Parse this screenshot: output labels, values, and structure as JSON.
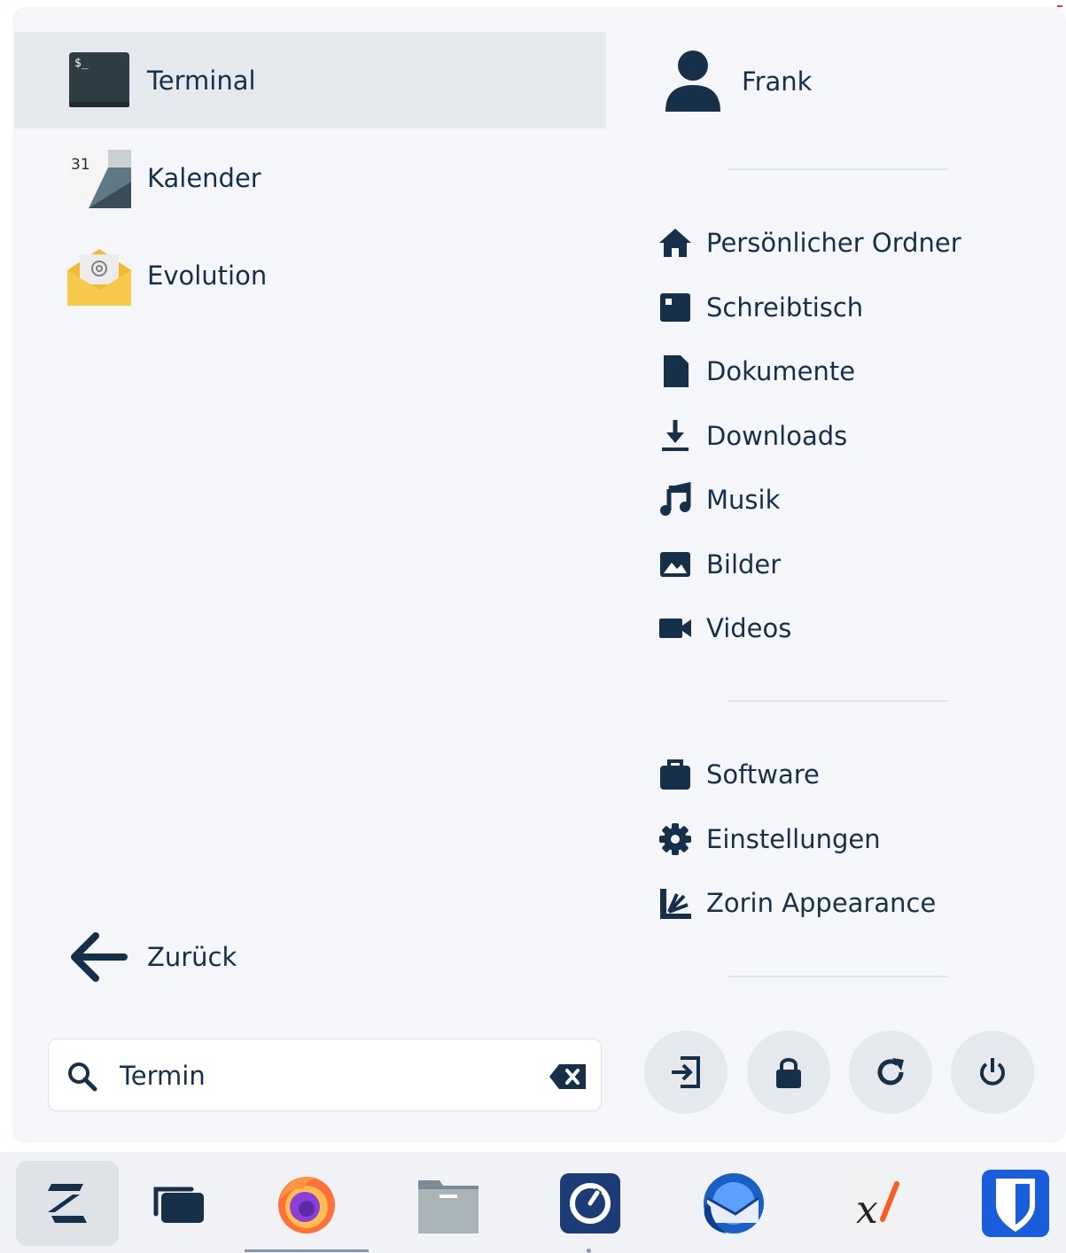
{
  "apps": [
    {
      "label": "Terminal",
      "icon": "terminal-icon",
      "selected": true
    },
    {
      "label": "Kalender",
      "icon": "calendar-icon",
      "selected": false
    },
    {
      "label": "Evolution",
      "icon": "evolution-mail-icon",
      "selected": false
    }
  ],
  "calendar_day": "31",
  "back": {
    "label": "Zurück",
    "icon": "arrow-left-icon"
  },
  "search": {
    "value": "Termin",
    "icon": "search-icon",
    "clear_icon": "backspace-icon"
  },
  "user": {
    "name": "Frank",
    "icon": "user-icon"
  },
  "places": [
    {
      "label": "Persönlicher Ordner",
      "icon": "home-icon"
    },
    {
      "label": "Schreibtisch",
      "icon": "desktop-icon"
    },
    {
      "label": "Dokumente",
      "icon": "document-icon"
    },
    {
      "label": "Downloads",
      "icon": "download-icon"
    },
    {
      "label": "Musik",
      "icon": "music-icon"
    },
    {
      "label": "Bilder",
      "icon": "image-icon"
    },
    {
      "label": "Videos",
      "icon": "video-icon"
    }
  ],
  "system_items": [
    {
      "label": "Software",
      "icon": "software-bag-icon"
    },
    {
      "label": "Einstellungen",
      "icon": "gear-icon"
    },
    {
      "label": "Zorin Appearance",
      "icon": "appearance-icon"
    }
  ],
  "session_buttons": [
    {
      "icon": "logout-icon"
    },
    {
      "icon": "lock-icon"
    },
    {
      "icon": "restart-icon"
    },
    {
      "icon": "power-icon"
    }
  ],
  "taskbar": [
    {
      "icon": "zorin-menu-icon",
      "active": true
    },
    {
      "icon": "workspaces-icon",
      "active": false
    },
    {
      "icon": "firefox-icon",
      "active": false
    },
    {
      "icon": "files-icon",
      "active": false
    },
    {
      "icon": "timer-icon",
      "active": false
    },
    {
      "icon": "thunderbird-icon",
      "active": false
    },
    {
      "icon": "xournal-icon",
      "active": false
    },
    {
      "icon": "bitwarden-icon",
      "active": false
    }
  ],
  "colors": {
    "text": "#17304a",
    "menu_bg": "#f4f6fa",
    "selected_bg": "#e5e8ec",
    "taskbar_bg": "#f0f2f5",
    "accent_blue": "#175ddc"
  }
}
